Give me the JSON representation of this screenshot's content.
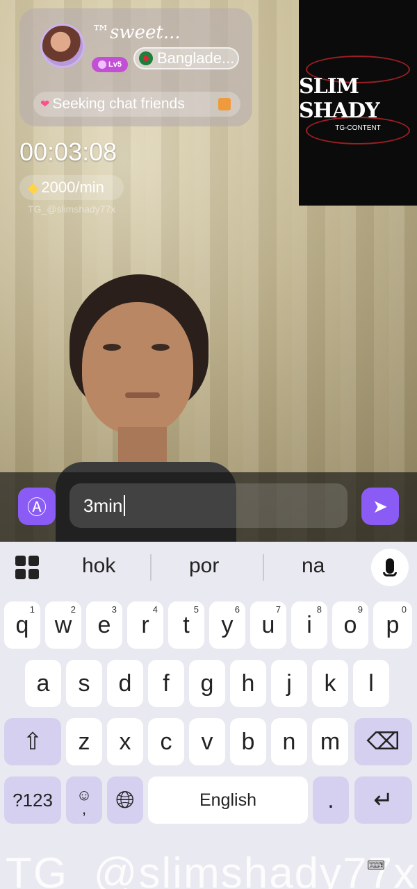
{
  "profile": {
    "username": "™sweet...",
    "level": "Lv5",
    "country": "Banglade...",
    "status": "Seeking chat friends"
  },
  "call": {
    "timer": "00:03:08",
    "rate": "2000/min",
    "overlay_watermark": "TG_@slimshady77x"
  },
  "remote_logo": {
    "title": "SLIM SHADY",
    "subtitle": "TG-CONTENT"
  },
  "composer": {
    "message_text": "3min"
  },
  "keyboard": {
    "suggestions": [
      "hok",
      "por",
      "na"
    ],
    "row1": [
      {
        "key": "q",
        "hint": "1"
      },
      {
        "key": "w",
        "hint": "2"
      },
      {
        "key": "e",
        "hint": "3"
      },
      {
        "key": "r",
        "hint": "4"
      },
      {
        "key": "t",
        "hint": "5"
      },
      {
        "key": "y",
        "hint": "6"
      },
      {
        "key": "u",
        "hint": "7"
      },
      {
        "key": "i",
        "hint": "8"
      },
      {
        "key": "o",
        "hint": "9"
      },
      {
        "key": "p",
        "hint": "0"
      }
    ],
    "row2": [
      "a",
      "s",
      "d",
      "f",
      "g",
      "h",
      "j",
      "k",
      "l"
    ],
    "row3": [
      "z",
      "x",
      "c",
      "v",
      "b",
      "n",
      "m"
    ],
    "symbols_label": "?123",
    "emoji_comma": ",",
    "space_label": "English",
    "period_label": "."
  },
  "watermark": "TG_@slimshady77x"
}
